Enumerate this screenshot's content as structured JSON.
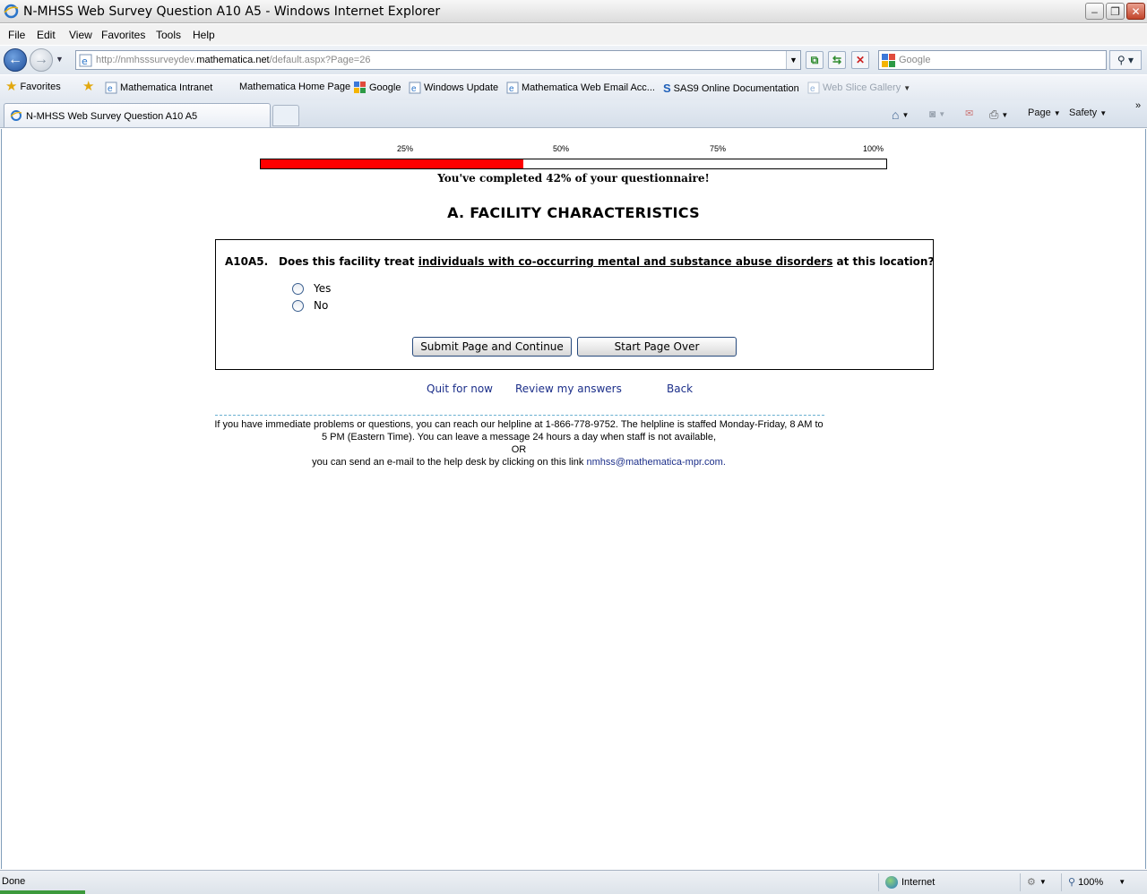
{
  "window": {
    "title": "N-MHSS Web Survey Question A10 A5 - Windows Internet Explorer"
  },
  "menu": [
    "File",
    "Edit",
    "View",
    "Favorites",
    "Tools",
    "Help"
  ],
  "address": {
    "url_prefix": "http://nmhsssurveydev.",
    "url_domain": "mathematica.net",
    "url_path": "/default.aspx?Page=26",
    "search_placeholder": "Google"
  },
  "favorites": {
    "label": "Favorites",
    "items": [
      "Mathematica Intranet",
      "Mathematica Home Page",
      "Google",
      "Windows Update",
      "Mathematica Web Email Acc...",
      "SAS9 Online Documentation",
      "Web Slice Gallery"
    ]
  },
  "tab": {
    "label": "N-MHSS Web Survey Question A10 A5"
  },
  "commandbar": {
    "page": "Page",
    "safety": "Safety"
  },
  "progress": {
    "ticks": [
      "25%",
      "50%",
      "75%",
      "100%"
    ],
    "fraction": 0.42,
    "fill_color": "#ff0000",
    "message": "You've completed 42% of your questionnaire!"
  },
  "section_title": "A. FACILITY CHARACTERISTICS",
  "question": {
    "number": "A10A5.",
    "text_before": "Does this facility treat ",
    "text_underlined": "individuals with co-occurring mental and substance abuse disorders",
    "text_after": " at this location?",
    "options": [
      "Yes",
      "No"
    ]
  },
  "buttons": {
    "submit": "Submit Page and Continue",
    "start_over": "Start Page Over"
  },
  "nav_links": {
    "quit": "Quit for now",
    "review": "Review my answers",
    "back": "Back"
  },
  "help": {
    "line1": "If you have immediate problems or questions, you can reach our helpline at 1-866-778-9752. The helpline is staffed Monday-Friday, 8 AM to 5 PM (Eastern Time). You can leave a message 24 hours a day when staff is not available,",
    "or": "OR",
    "line2": "you can send an e-mail to the help desk by clicking on this link ",
    "email": "nmhss@mathematica-mpr.com."
  },
  "status": {
    "done": "Done",
    "zone": "Internet",
    "zoom": "100%"
  }
}
